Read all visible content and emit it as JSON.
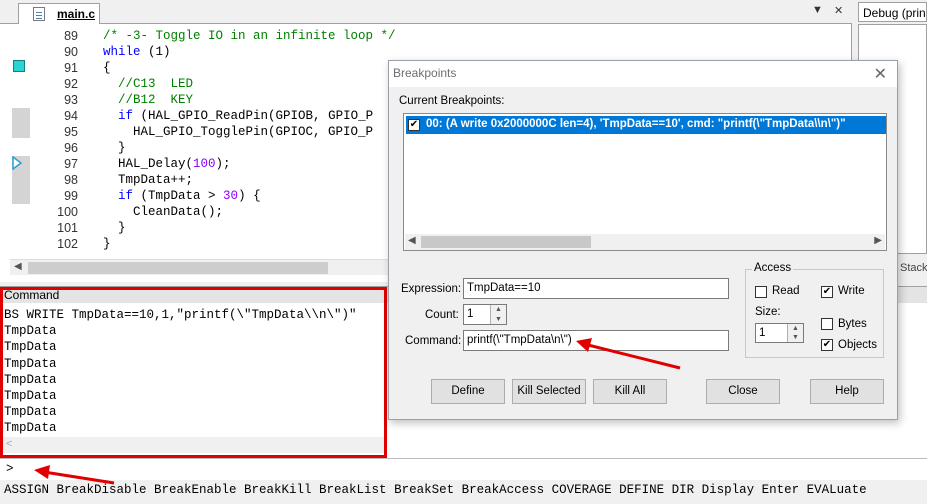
{
  "editor": {
    "tab_label": "main.c",
    "line_numbers": [
      "89",
      "90",
      "91",
      "92",
      "93",
      "94",
      "95",
      "96",
      "97",
      "98",
      "99",
      "100",
      "101",
      "102"
    ],
    "code_lines": [
      {
        "parts": [
          {
            "t": "  ",
            "c": ""
          },
          {
            "t": "/* -3- Toggle IO in an infinite loop */",
            "c": "cmt"
          }
        ]
      },
      {
        "parts": [
          {
            "t": "  ",
            "c": ""
          },
          {
            "t": "while",
            "c": "kw"
          },
          {
            "t": " (1)",
            "c": ""
          }
        ]
      },
      {
        "parts": [
          {
            "t": "  {",
            "c": ""
          }
        ]
      },
      {
        "parts": [
          {
            "t": "    ",
            "c": ""
          },
          {
            "t": "//C13  LED",
            "c": "cmt"
          }
        ]
      },
      {
        "parts": [
          {
            "t": "    ",
            "c": ""
          },
          {
            "t": "//B12  KEY",
            "c": "cmt"
          }
        ]
      },
      {
        "parts": [
          {
            "t": "    ",
            "c": ""
          },
          {
            "t": "if",
            "c": "kw"
          },
          {
            "t": " (HAL_GPIO_ReadPin(GPIOB, GPIO_P",
            "c": ""
          }
        ]
      },
      {
        "parts": [
          {
            "t": "      HAL_GPIO_TogglePin(GPIOC, GPIO_P",
            "c": ""
          }
        ]
      },
      {
        "parts": [
          {
            "t": "    }",
            "c": ""
          }
        ]
      },
      {
        "parts": [
          {
            "t": "    HAL_Delay(",
            "c": ""
          },
          {
            "t": "100",
            "c": "num"
          },
          {
            "t": ");",
            "c": ""
          }
        ]
      },
      {
        "parts": [
          {
            "t": "    TmpData++;",
            "c": ""
          }
        ]
      },
      {
        "parts": [
          {
            "t": "    ",
            "c": ""
          },
          {
            "t": "if",
            "c": "kw"
          },
          {
            "t": " (TmpData > ",
            "c": ""
          },
          {
            "t": "30",
            "c": "num"
          },
          {
            "t": ") {",
            "c": ""
          }
        ]
      },
      {
        "parts": [
          {
            "t": "      CleanData();",
            "c": ""
          }
        ]
      },
      {
        "parts": [
          {
            "t": "    }",
            "c": ""
          }
        ]
      },
      {
        "parts": [
          {
            "t": "  }",
            "c": ""
          }
        ]
      }
    ],
    "window_controls": {
      "dropdown": "▼",
      "close": "✕"
    }
  },
  "debug_panel": {
    "title": "Debug (printf)",
    "stack_label": "Stack"
  },
  "command": {
    "title": "Command",
    "output": [
      "BS WRITE TmpData==10,1,\"printf(\\\"TmpData\\\\n\\\")\"",
      "TmpData",
      "TmpData",
      "TmpData",
      "TmpData",
      "TmpData",
      "TmpData",
      "TmpData"
    ],
    "prompt": ">",
    "help_line": "ASSIGN BreakDisable BreakEnable BreakKill BreakList BreakSet BreakAccess COVERAGE DEFINE DIR Display Enter EVALuate"
  },
  "dialog": {
    "title": "Breakpoints",
    "current_label": "Current Breakpoints:",
    "breakpoint_entry": "00: (A write 0x2000000C len=4),  'TmpData==10',  cmd: \"printf(\\\"TmpData\\\\n\\\")\"",
    "expression_label": "Expression:",
    "expression_value": "TmpData==10",
    "count_label": "Count:",
    "count_value": "1",
    "command_label": "Command:",
    "command_value": "printf(\\\"TmpData\\n\\\")",
    "access": {
      "title": "Access",
      "read_label": "Read",
      "read_checked": false,
      "write_label": "Write",
      "write_checked": true,
      "size_label": "Size:",
      "size_value": "1",
      "bytes_label": "Bytes",
      "bytes_checked": false,
      "objects_label": "Objects",
      "objects_checked": true
    },
    "buttons": {
      "define": "Define",
      "kill_selected": "Kill Selected",
      "kill_all": "Kill All",
      "close": "Close",
      "help": "Help"
    }
  },
  "colors": {
    "annotation_red": "#e00000",
    "selection_blue": "#0078d7"
  }
}
